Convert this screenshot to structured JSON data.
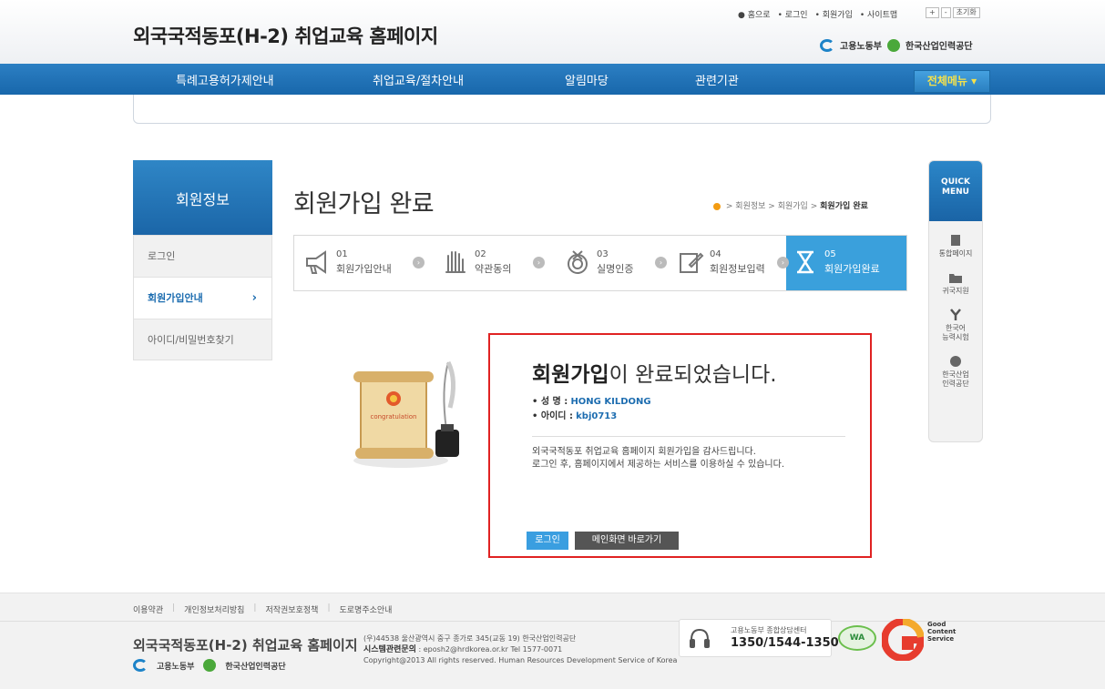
{
  "header": {
    "site_title": "외국국적동포(H-2) 취업교육 홈페이지",
    "util_links": [
      "홈으로",
      "로그인",
      "회원가입",
      "사이트맵"
    ],
    "font_controls": [
      "+",
      "-",
      "초기화"
    ],
    "logo1": "고용노동부",
    "logo2": "한국산업인력공단"
  },
  "nav": {
    "items": [
      "특례고용허가제안내",
      "취업교육/절차안내",
      "알림마당",
      "관련기관"
    ],
    "all_menu": "전체메뉴"
  },
  "left_menu": {
    "title": "회원정보",
    "items": [
      "로그인",
      "회원가입안내",
      "아이디/비밀번호찾기"
    ],
    "active_index": 1
  },
  "page": {
    "title": "회원가입 완료",
    "breadcrumb": [
      ">",
      "회원정보",
      ">",
      "회원가입",
      ">",
      "회원가입 완료"
    ]
  },
  "steps": [
    {
      "num": "01",
      "label": "회원가입안내"
    },
    {
      "num": "02",
      "label": "약관동의"
    },
    {
      "num": "03",
      "label": "실명인증"
    },
    {
      "num": "04",
      "label": "회원정보입력"
    },
    {
      "num": "05",
      "label": "회원가입완료"
    }
  ],
  "result": {
    "title_bold": "회원가입",
    "title_rest": "이 완료되었습니다.",
    "name_label": "• 성   명 :",
    "name_value": "HONG KILDONG",
    "id_label": "• 아이디 :",
    "id_value": "kbj0713",
    "msg1": "외국국적동포 취업교육 홈페이지 회원가입을 감사드립니다.",
    "msg2": "로그인 후, 홈페이지에서 제공하는 서비스를 이용하실 수 있습니다.",
    "btn_login": "로그인",
    "btn_main": "메인화면 바로가기",
    "scroll_text": "congratulation"
  },
  "quick_menu": {
    "title1": "QUICK",
    "title2": "MENU",
    "items": [
      {
        "label1": "통합페이지",
        "label2": ""
      },
      {
        "label1": "귀국지원",
        "label2": ""
      },
      {
        "label1": "한국어",
        "label2": "능력시험"
      },
      {
        "label1": "한국산업",
        "label2": "인력공단"
      }
    ]
  },
  "footer": {
    "links": [
      "이용약관",
      "개인정보처리방침",
      "저작권보호정책",
      "도로명주소안내"
    ],
    "title": "외국국적동포(H-2) 취업교육 홈페이지",
    "logo1": "고용노동부",
    "logo2": "한국산업인력공단",
    "address": "(우)44538 울산광역시 중구 종가로 345(교동 19) 한국산업인력공단",
    "system_label": "시스템관련문의",
    "system_contact": ": eposh2@hrdkorea.or.kr  Tel 1577-0071",
    "copyright": "Copyright@2013 All rights reserved. Human Resources Development Service of Korea",
    "call_label": "고용노동부 종합상담센터",
    "call_number": "1350/1544-1350",
    "badge_wa": "WA",
    "gc_lines": [
      "Good",
      "Content",
      "Service"
    ]
  }
}
